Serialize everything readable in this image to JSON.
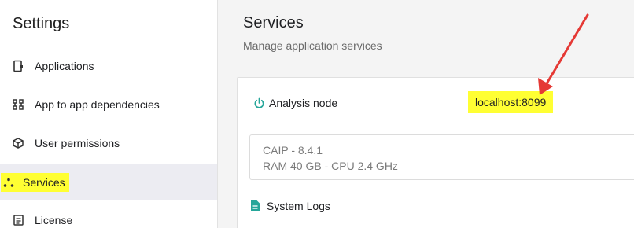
{
  "sidebar": {
    "title": "Settings",
    "items": [
      {
        "label": "Applications",
        "icon": "applications-icon"
      },
      {
        "label": "App to app dependencies",
        "icon": "dependencies-icon"
      },
      {
        "label": "User permissions",
        "icon": "cube-icon"
      },
      {
        "label": "Services",
        "icon": "services-icon",
        "active": true
      },
      {
        "label": "License",
        "icon": "license-icon"
      }
    ]
  },
  "main": {
    "title": "Services",
    "subtitle": "Manage application services"
  },
  "service": {
    "name": "Analysis node",
    "host": "localhost:8099",
    "version": "CAIP - 8.4.1",
    "resources": "RAM 40 GB - CPU 2.4 GHz",
    "logs_label": "System Logs"
  },
  "colors": {
    "highlight": "#ffff33",
    "accent": "#26a69a",
    "annotation_arrow": "#e53935"
  }
}
